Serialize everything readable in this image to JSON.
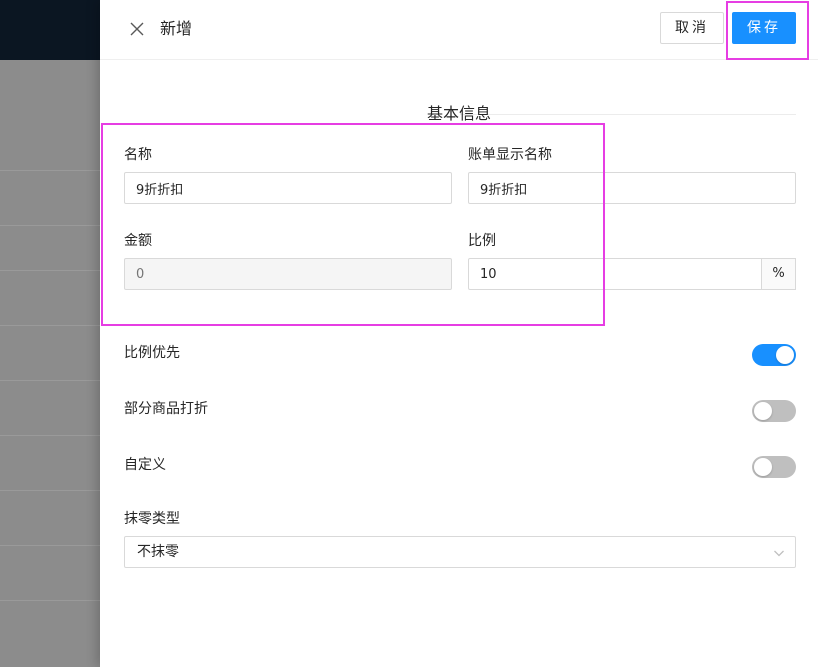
{
  "header": {
    "title": "新增",
    "cancel_label": "取消",
    "save_label": "保存",
    "close_icon": "close-icon"
  },
  "section": {
    "title": "基本信息"
  },
  "form": {
    "name": {
      "label": "名称",
      "value": "9折折扣"
    },
    "bill_name": {
      "label": "账单显示名称",
      "value": "9折折扣"
    },
    "amount": {
      "label": "金额",
      "placeholder": "0"
    },
    "ratio": {
      "label": "比例",
      "value": "10",
      "suffix": "%"
    }
  },
  "toggles": [
    {
      "label": "比例优先",
      "on": true
    },
    {
      "label": "部分商品打折",
      "on": false
    },
    {
      "label": "自定义",
      "on": false
    }
  ],
  "rounding": {
    "label": "抹零类型",
    "value": "不抹零",
    "icon": "chevron-down-icon"
  },
  "colors": {
    "primary": "#1890ff",
    "annotation": "#e63de3"
  }
}
